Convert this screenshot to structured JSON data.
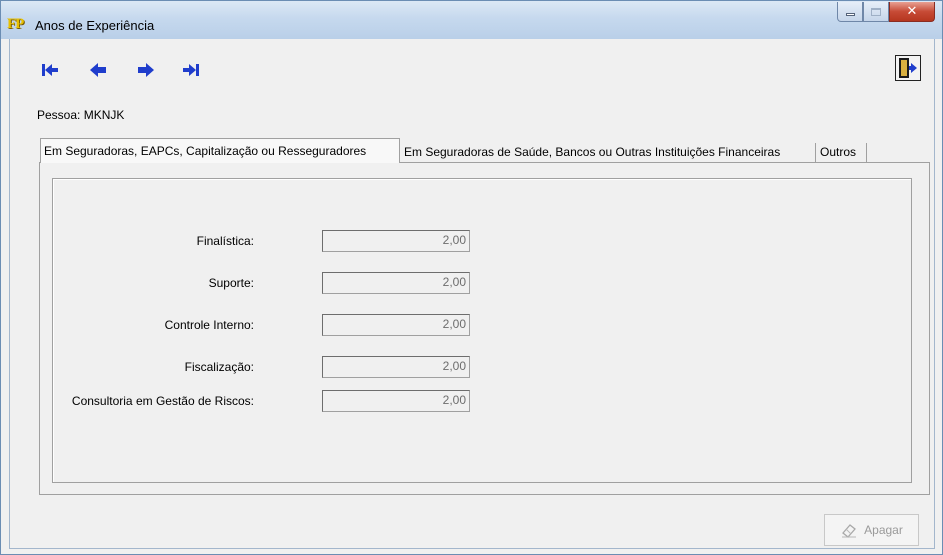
{
  "window": {
    "title": "Anos de Experiência",
    "logo_text": "FP",
    "close_glyph": "✕"
  },
  "toolbar": {
    "buttons": [
      {
        "name": "first-record",
        "icon": "first-icon"
      },
      {
        "name": "previous-record",
        "icon": "arrow-left-icon"
      },
      {
        "name": "next-record",
        "icon": "arrow-right-icon"
      },
      {
        "name": "last-record",
        "icon": "last-icon"
      }
    ],
    "exit_icon": "exit-door-icon",
    "icon_color": "#1f3dcc"
  },
  "pessoa_label": "Pessoa: MKNJK",
  "tabs": [
    {
      "label": "Em Seguradoras, EAPCs, Capitalização ou Resseguradores",
      "active": true
    },
    {
      "label": "Em Seguradoras de Saúde, Bancos ou Outras Instituições Financeiras",
      "active": false
    },
    {
      "label": "Outros",
      "active": false
    }
  ],
  "fields": [
    {
      "label": "Finalística:",
      "value": "2,00"
    },
    {
      "label": "Suporte:",
      "value": "2,00"
    },
    {
      "label": "Controle Interno:",
      "value": "2,00"
    },
    {
      "label": "Fiscalização:",
      "value": "2,00"
    },
    {
      "label": "Consultoria em Gestão de Riscos:",
      "value": "2,00"
    }
  ],
  "apagar_button": {
    "label": "Apagar",
    "icon": "eraser-icon",
    "enabled": false
  }
}
